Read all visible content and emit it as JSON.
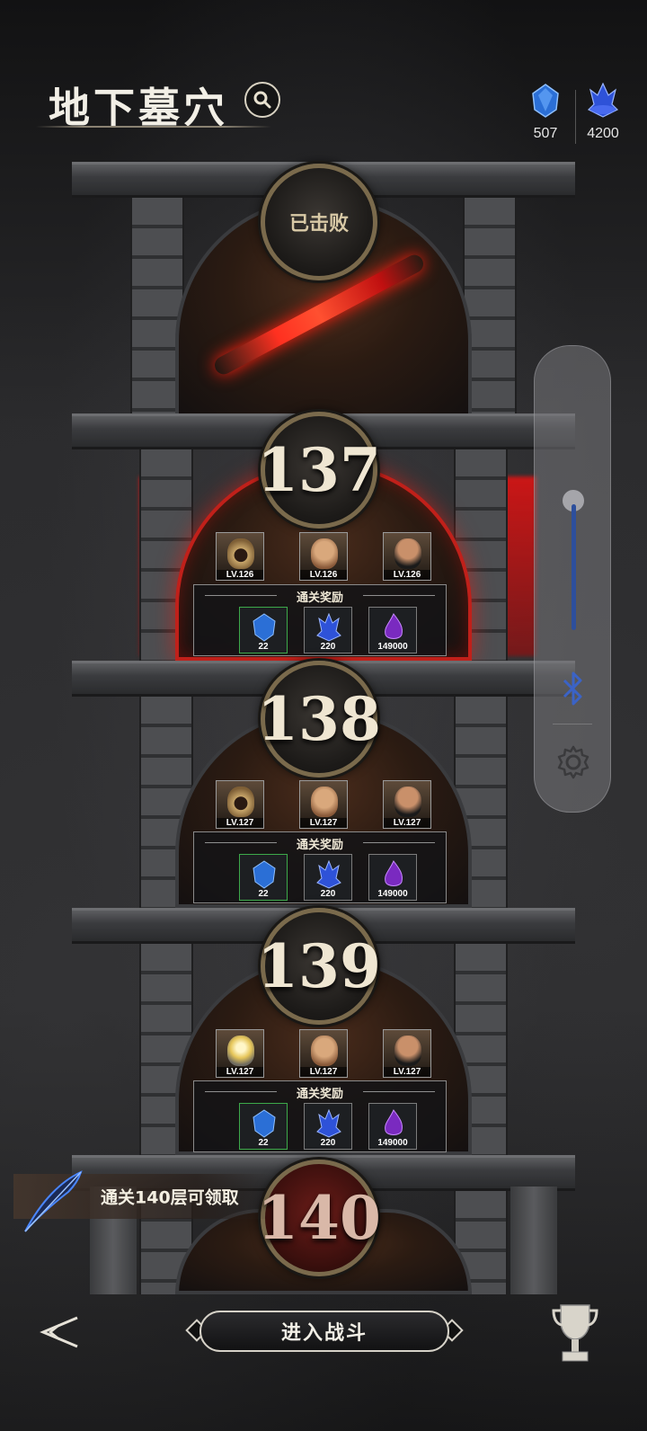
{
  "header": {
    "title": "地下墓穴"
  },
  "resources": [
    {
      "icon": "blue-crystal-icon",
      "value": "507"
    },
    {
      "icon": "blue-flame-crystal-icon",
      "value": "4200"
    }
  ],
  "floors": {
    "defeated": {
      "status": "已击败"
    },
    "f137": {
      "number": "137",
      "enemies": [
        "LV.126",
        "LV.126",
        "LV.126"
      ],
      "reward_title": "通关奖励",
      "rewards": [
        "22",
        "220",
        "149000"
      ]
    },
    "f138": {
      "number": "138",
      "enemies": [
        "LV.127",
        "LV.127",
        "LV.127"
      ],
      "reward_title": "通关奖励",
      "rewards": [
        "22",
        "220",
        "149000"
      ]
    },
    "f139": {
      "number": "139",
      "enemies": [
        "LV.127",
        "LV.127",
        "LV.127"
      ],
      "reward_title": "通关奖励",
      "rewards": [
        "22",
        "220",
        "149000"
      ]
    },
    "f140": {
      "number": "140"
    }
  },
  "promo": {
    "text": "通关140层可领取"
  },
  "actions": {
    "fight": "进入战斗"
  },
  "colors": {
    "accent_red": "#c0201a",
    "gold_border": "#7a6a4c",
    "crystal_blue": "#3a7dff",
    "crystal_purple": "#9a3ad6",
    "slider_blue": "#2d4f9c"
  }
}
